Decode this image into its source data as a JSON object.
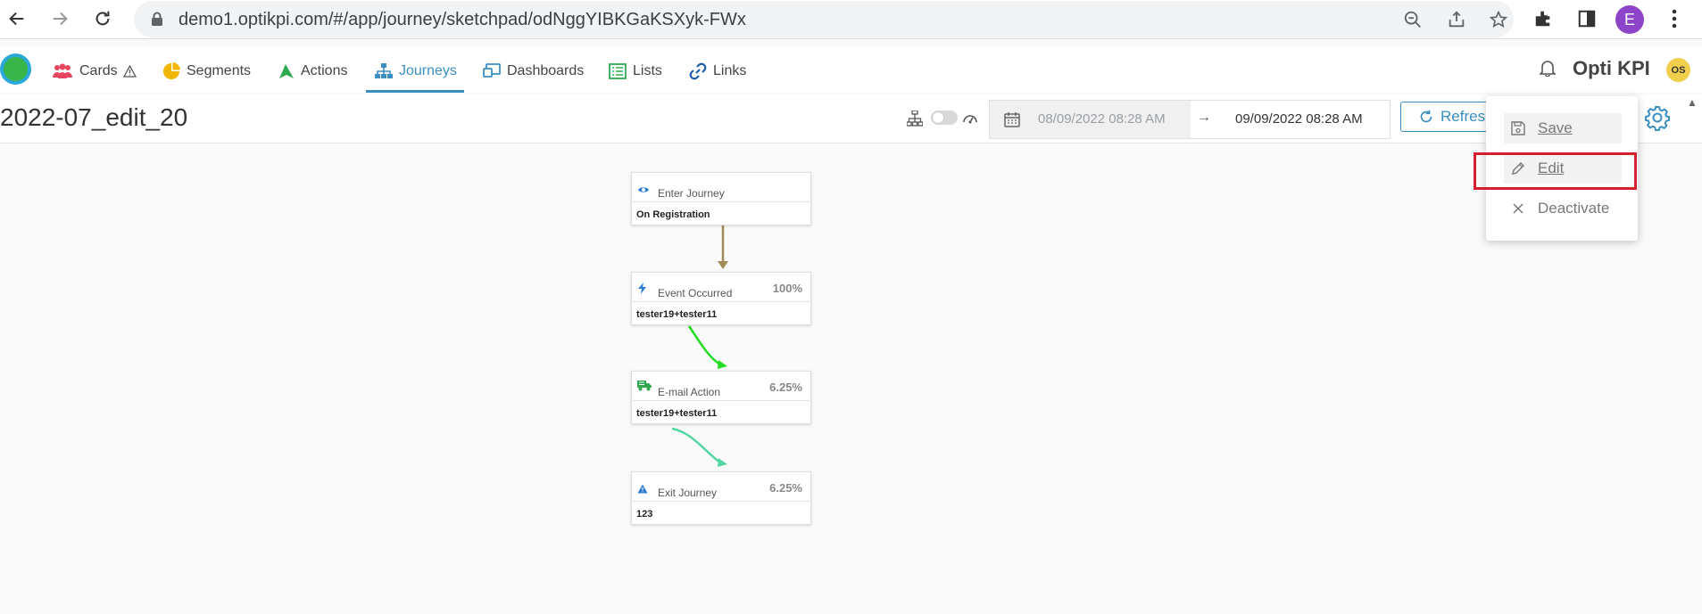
{
  "browser": {
    "url": "demo1.optikpi.com/#/app/journey/sketchpad/odNggYIBKGaKSXyk-FWx",
    "profile_initial": "E",
    "icons": [
      "back-icon",
      "forward-icon",
      "reload-icon",
      "lock-icon",
      "zoom-icon",
      "share-icon",
      "star-icon",
      "extensions-icon",
      "sidepanel-icon",
      "more-icon"
    ]
  },
  "nav": {
    "items": [
      {
        "label": "Cards",
        "icon": "people-icon",
        "badge_icon": "warning-icon"
      },
      {
        "label": "Segments",
        "icon": "pie-icon"
      },
      {
        "label": "Actions",
        "icon": "send-icon"
      },
      {
        "label": "Journeys",
        "icon": "sitemap-icon",
        "active": true
      },
      {
        "label": "Dashboards",
        "icon": "dashboard-icon"
      },
      {
        "label": "Lists",
        "icon": "list-icon"
      },
      {
        "label": "Links",
        "icon": "link-icon"
      }
    ],
    "brand": "Opti KPI",
    "user_initials": "OS"
  },
  "toolbar": {
    "title": "2022-07_edit_20",
    "date_from": "08/09/2022 08:28 AM",
    "date_arrow": "→",
    "date_to": "09/09/2022 08:28 AM",
    "refresh_label": "Refresh"
  },
  "menu": {
    "save": "Save",
    "edit": "Edit",
    "deactivate": "Deactivate"
  },
  "flow": {
    "nodes": [
      {
        "type": "Enter Journey",
        "value": "On Registration",
        "percent": "",
        "icon": "eye-icon"
      },
      {
        "type": "Event Occurred",
        "value": "tester19+tester11",
        "percent": "100%",
        "icon": "bolt-icon"
      },
      {
        "type": "E-mail Action",
        "value": "tester19+tester11",
        "percent": "6.25%",
        "icon": "truck-icon"
      },
      {
        "type": "Exit Journey",
        "value": "123",
        "percent": "6.25%",
        "icon": "warning-icon"
      }
    ]
  },
  "colors": {
    "accent": "#3a8fc0",
    "highlight": "#d3202f",
    "connector1": "#a08a57",
    "connector2": "#22dd22",
    "connector3": "#55d6a0"
  }
}
